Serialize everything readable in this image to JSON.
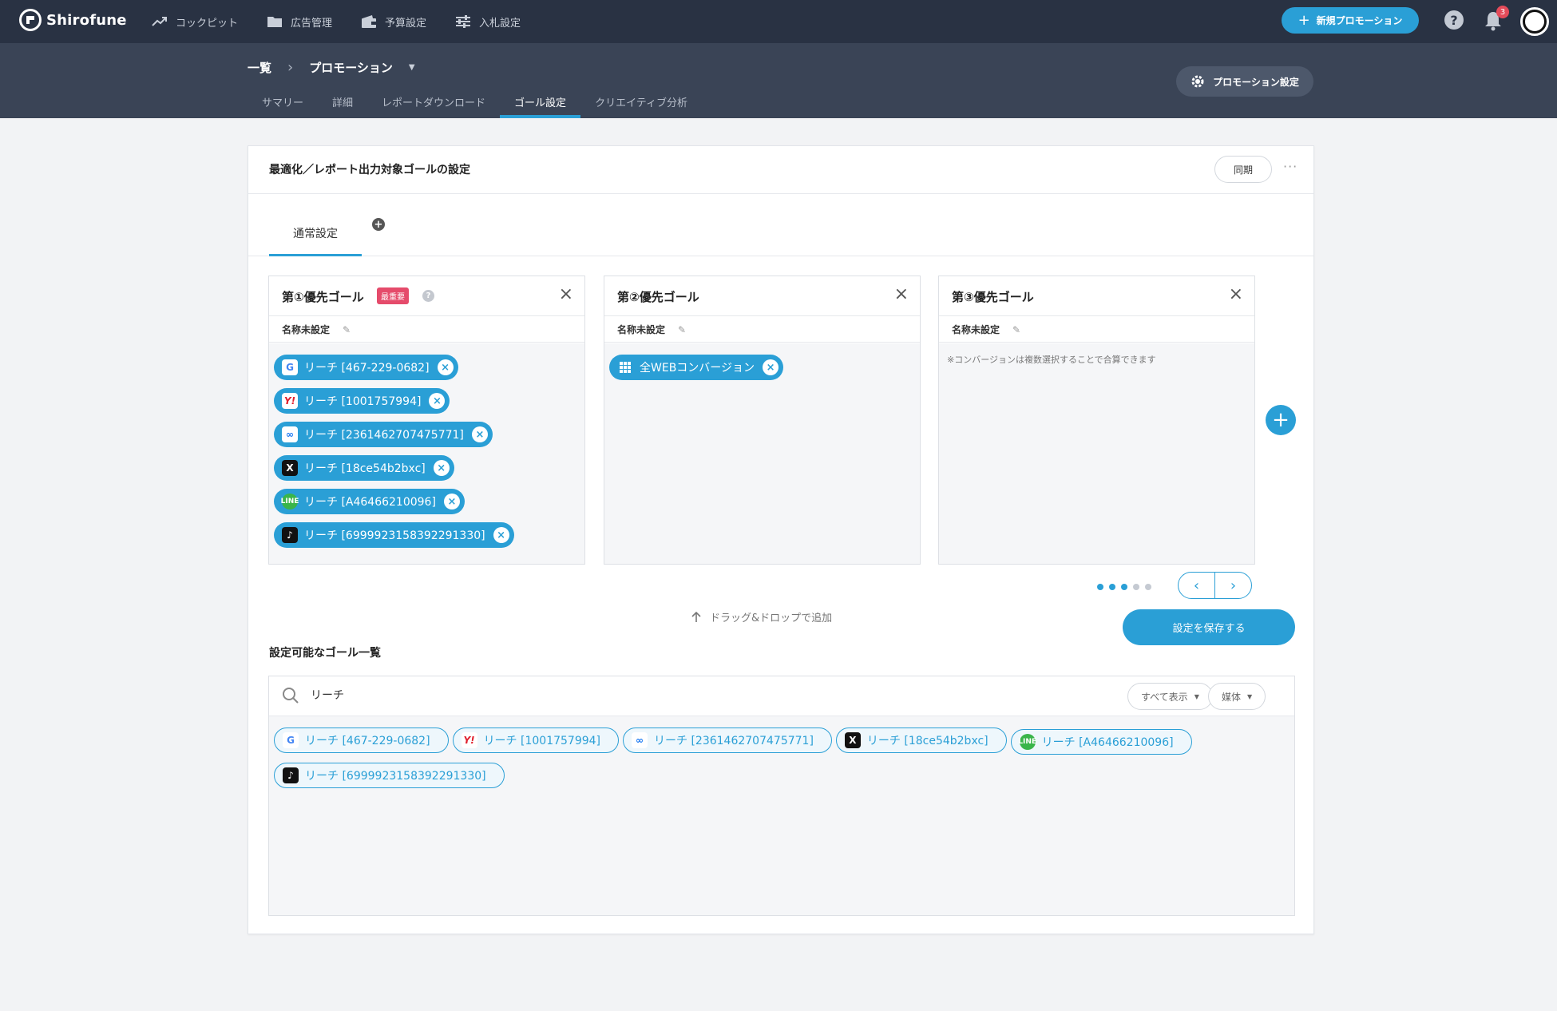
{
  "app": {
    "name": "Shirofune"
  },
  "nav": {
    "items": [
      {
        "label": "コックピット",
        "icon": "trend-icon"
      },
      {
        "label": "広告管理",
        "icon": "folder-icon"
      },
      {
        "label": "予算設定",
        "icon": "wallet-icon"
      },
      {
        "label": "入札設定",
        "icon": "sliders-icon"
      }
    ],
    "new_promotion": "新規プロモーション",
    "notification_count": "3"
  },
  "breadcrumb": {
    "root": "一覧",
    "current": "プロモーション"
  },
  "tabs": [
    "サマリー",
    "詳細",
    "レポートダウンロード",
    "ゴール設定",
    "クリエイティブ分析"
  ],
  "active_tab": "ゴール設定",
  "promotion_settings": "プロモーション設定",
  "card": {
    "title": "最適化／レポート出力対象ゴールの設定",
    "sync_label": "同期",
    "inner_tab": "通常設定"
  },
  "goals": [
    {
      "title": "第①優先ゴール",
      "badge": "最重要",
      "name": "名称未設定",
      "chips": [
        {
          "media": "google",
          "label": "リーチ [467-229-0682]"
        },
        {
          "media": "yahoo",
          "label": "リーチ [1001757994]"
        },
        {
          "media": "meta",
          "label": "リーチ [2361462707475771]"
        },
        {
          "media": "x",
          "label": "リーチ [18ce54b2bxc]"
        },
        {
          "media": "line",
          "label": "リーチ [A46466210096]"
        },
        {
          "media": "tiktok",
          "label": "リーチ [6999923158392291330]"
        }
      ]
    },
    {
      "title": "第②優先ゴール",
      "name": "名称未設定",
      "chips": [
        {
          "media": "grid",
          "label": "全WEBコンバージョン"
        }
      ]
    },
    {
      "title": "第③優先ゴール",
      "name": "名称未設定",
      "hint": "※コンバージョンは複数選択することで合算できます",
      "chips": []
    }
  ],
  "pagination": {
    "pages": 5,
    "active_pages": 3
  },
  "drag_hint": "ドラッグ&ドロップで追加",
  "save_label": "設定を保存する",
  "available": {
    "title": "設定可能なゴール一覧",
    "search_value": "リーチ",
    "filter_all": "すべて表示",
    "filter_media": "媒体",
    "chips": [
      {
        "media": "google",
        "label": "リーチ [467-229-0682]"
      },
      {
        "media": "yahoo",
        "label": "リーチ [1001757994]"
      },
      {
        "media": "meta",
        "label": "リーチ [2361462707475771]"
      },
      {
        "media": "x",
        "label": "リーチ [18ce54b2bxc]"
      },
      {
        "media": "line",
        "label": "リーチ [A46466210096]"
      },
      {
        "media": "tiktok",
        "label": "リーチ [6999923158392291330]"
      }
    ]
  },
  "colors": {
    "accent": "#2a9fd6",
    "topbar": "#293243",
    "subheader": "#3a4456",
    "badge": "#e54b6b"
  }
}
